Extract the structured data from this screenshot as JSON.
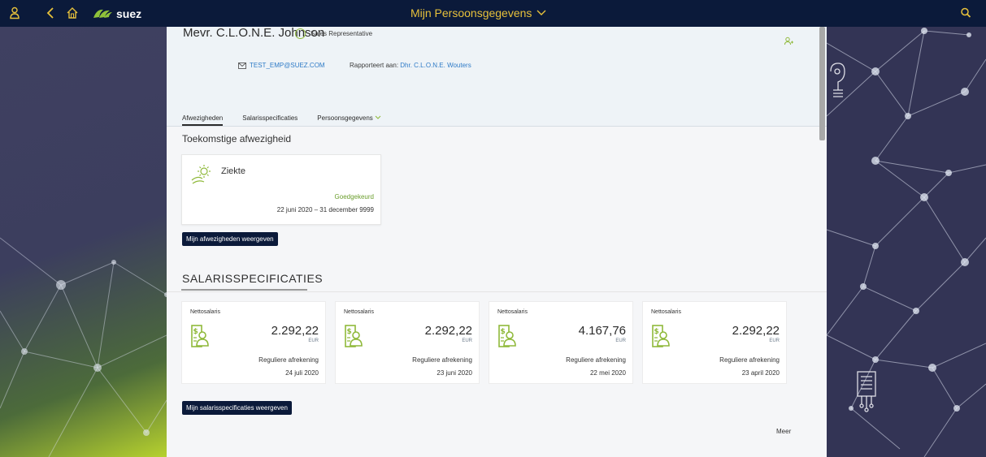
{
  "topbar": {
    "title": "Mijn Persoonsgegevens",
    "logo_text": "suez",
    "icons": [
      "user-icon",
      "back-icon",
      "home-icon",
      "search-icon",
      "chevron-down-icon"
    ],
    "accent_color": "#e7c13b",
    "bar_color": "#0b1a3a"
  },
  "employee": {
    "name": "Mevr. C.L.O.N.E. Johnson",
    "role": "Sales Representative",
    "email": "TEST_EMP@SUEZ.COM",
    "reports_to_label": "Rapporteert aan:",
    "reports_to": "Dhr. C.L.O.N.E. Wouters"
  },
  "tabs": [
    {
      "label": "Afwezigheden"
    },
    {
      "label": "Salarisspecificaties"
    },
    {
      "label": "Persoonsgegevens"
    }
  ],
  "absence_section": {
    "title": "Toekomstige afwezigheid",
    "card": {
      "type": "Ziekte",
      "status": "Goedgekeurd",
      "dates": "22 juni 2020 – 31 december 9999"
    },
    "button_label": "Mijn afwezigheden weergeven"
  },
  "salary_section": {
    "title": "SALARISSPECIFICATIES",
    "cards": [
      {
        "label": "Nettosalaris",
        "amount": "2.292,22",
        "currency": "EUR",
        "type": "Reguliere afrekening",
        "date": "24 juli 2020"
      },
      {
        "label": "Nettosalaris",
        "amount": "2.292,22",
        "currency": "EUR",
        "type": "Reguliere afrekening",
        "date": "23 juni 2020"
      },
      {
        "label": "Nettosalaris",
        "amount": "4.167,76",
        "currency": "EUR",
        "type": "Reguliere afrekening",
        "date": "22 mei 2020"
      },
      {
        "label": "Nettosalaris",
        "amount": "2.292,22",
        "currency": "EUR",
        "type": "Reguliere afrekening",
        "date": "23 april 2020"
      }
    ],
    "button_label": "Mijn salarisspecificaties weergeven",
    "more_label": "Meer"
  },
  "colors": {
    "approved_green": "#6b9e2d",
    "icon_green": "#8fb93a",
    "link_blue": "#2f7bc7"
  }
}
